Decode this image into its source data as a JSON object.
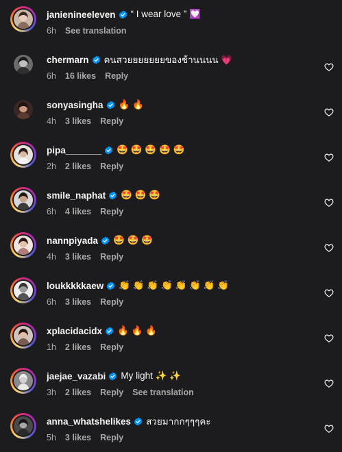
{
  "icons": {
    "verified": "verified-badge-icon",
    "like": "heart-outline-icon"
  },
  "colors": {
    "verified": "#0095f6",
    "background": "#1c1c1e",
    "meta": "#a8a8a8"
  },
  "comments": [
    {
      "username": "janienineeleven",
      "text": "“ I wear love ” 💟",
      "time": "6h",
      "likes": "",
      "reply": "",
      "translate": "See translation",
      "heart": false,
      "ring": true
    },
    {
      "username": "chermarn",
      "text": "คนสวยยยยยยยของช้านนนน 💗",
      "time": "6h",
      "likes": "16 likes",
      "reply": "Reply",
      "translate": "",
      "heart": true,
      "ring": false
    },
    {
      "username": "sonyasingha",
      "text": "🔥 🔥",
      "time": "4h",
      "likes": "3 likes",
      "reply": "Reply",
      "translate": "",
      "heart": true,
      "ring": false
    },
    {
      "username": "pipa_______",
      "text": "🤩 🤩 🤩 🤩 🤩",
      "time": "2h",
      "likes": "2 likes",
      "reply": "Reply",
      "translate": "",
      "heart": true,
      "ring": true
    },
    {
      "username": "smile_naphat",
      "text": "🤩 🤩 🤩",
      "time": "6h",
      "likes": "4 likes",
      "reply": "Reply",
      "translate": "",
      "heart": true,
      "ring": true
    },
    {
      "username": "nannpiyada",
      "text": "🤩 🤩 🤩",
      "time": "4h",
      "likes": "3 likes",
      "reply": "Reply",
      "translate": "",
      "heart": true,
      "ring": true
    },
    {
      "username": "loukkkkkaew",
      "text": "👏 👏 👏 👏 👏 👏 👏 👏",
      "time": "6h",
      "likes": "3 likes",
      "reply": "Reply",
      "translate": "",
      "heart": true,
      "ring": true
    },
    {
      "username": "xplacidacidx",
      "text": "🔥 🔥 🔥",
      "time": "1h",
      "likes": "2 likes",
      "reply": "Reply",
      "translate": "",
      "heart": true,
      "ring": true
    },
    {
      "username": "jaejae_vazabi",
      "text": "My light ✨ ✨",
      "time": "3h",
      "likes": "2 likes",
      "reply": "Reply",
      "translate": "See translation",
      "heart": true,
      "ring": true
    },
    {
      "username": "anna_whatshelikes",
      "text": "สวยมากกๆๆๆคะ",
      "time": "5h",
      "likes": "3 likes",
      "reply": "Reply",
      "translate": "",
      "heart": true,
      "ring": true
    }
  ]
}
